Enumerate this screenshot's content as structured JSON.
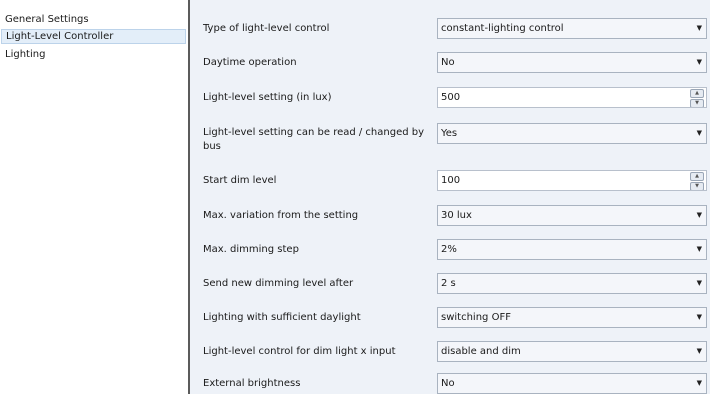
{
  "sidebar": {
    "items": [
      {
        "label": "General Settings",
        "selected": false
      },
      {
        "label": "Light-Level Controller",
        "selected": true
      },
      {
        "label": "Lighting",
        "selected": false
      }
    ]
  },
  "settings": {
    "rows": [
      {
        "label": "Type of light-level control",
        "value": "constant-lighting control",
        "control": "dropdown"
      },
      {
        "label": "Daytime operation",
        "value": "No",
        "control": "dropdown"
      },
      {
        "label": "Light-level setting (in lux)",
        "value": "500",
        "control": "spinner"
      },
      {
        "label": "Light-level setting can be read / changed by bus",
        "value": "Yes",
        "control": "dropdown"
      },
      {
        "label": "Start dim level",
        "value": "100",
        "control": "spinner"
      },
      {
        "label": "Max. variation from the setting",
        "value": "30 lux",
        "control": "dropdown"
      },
      {
        "label": "Max. dimming step",
        "value": "2%",
        "control": "dropdown"
      },
      {
        "label": "Send new dimming level after",
        "value": "2 s",
        "control": "dropdown"
      },
      {
        "label": "Lighting with sufficient daylight",
        "value": "switching OFF",
        "control": "dropdown"
      },
      {
        "label": "Light-level control for dim light x input",
        "value": "disable and dim",
        "control": "dropdown"
      },
      {
        "label": "External brightness",
        "value": "No",
        "control": "dropdown"
      }
    ]
  },
  "colors": {
    "panel_bg": "#eef2f8",
    "selected_bg": "#e3eef9",
    "divider": "#5b5b5b"
  },
  "icons": {
    "dropdown": "chevron-down-icon",
    "spinner_up": "arrow-up-icon",
    "spinner_down": "arrow-down-icon"
  }
}
